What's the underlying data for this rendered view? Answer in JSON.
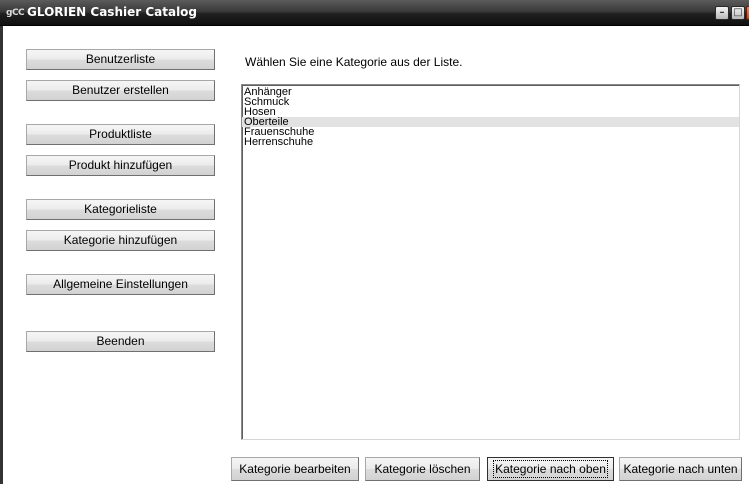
{
  "window": {
    "icon_text": "gCC",
    "title": "GLORIEN Cashier Catalog",
    "minimize_glyph": "–",
    "maximize_glyph": "□",
    "close_glyph": "✕"
  },
  "sidebar": {
    "buttons": [
      {
        "label": "Benutzerliste"
      },
      {
        "label": "Benutzer erstellen"
      },
      {
        "label": "Produktliste"
      },
      {
        "label": "Produkt hinzufügen"
      },
      {
        "label": "Kategorieliste"
      },
      {
        "label": "Kategorie hinzufügen"
      },
      {
        "label": "Allgemeine Einstellungen"
      },
      {
        "label": "Beenden"
      }
    ]
  },
  "main": {
    "instruction": "Wählen Sie eine Kategorie aus der Liste.",
    "categories": [
      "Anhänger",
      "Schmuck",
      "Hosen",
      "Oberteile",
      "Frauenschuhe",
      "Herrenschuhe"
    ],
    "selected_category": "Oberteile"
  },
  "actions": {
    "edit": "Kategorie bearbeiten",
    "delete": "Kategorie löschen",
    "move_up": "Kategorie nach oben",
    "move_down": "Kategorie nach unten"
  },
  "colors": {
    "selection": "#e2e2e2",
    "titlebar": "#202020",
    "button_face": "#e4e4e4"
  }
}
